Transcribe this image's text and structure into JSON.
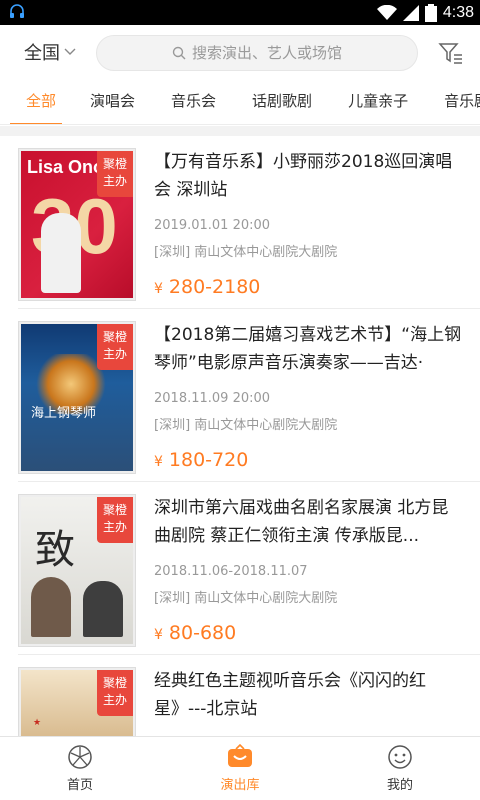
{
  "status_bar": {
    "time": "4:38"
  },
  "top_bar": {
    "city": "全国",
    "search_placeholder": "搜索演出、艺人或场馆"
  },
  "tabs": [
    {
      "label": "全部"
    },
    {
      "label": "演唱会"
    },
    {
      "label": "音乐会"
    },
    {
      "label": "话剧歌剧"
    },
    {
      "label": "儿童亲子"
    },
    {
      "label": "音乐剧"
    }
  ],
  "events": [
    {
      "badge": "聚橙\n主办",
      "poster_text": "Lisa Ono",
      "title": "【万有音乐系】小野丽莎2018巡回演唱会 深圳站",
      "date": "2019.01.01 20:00",
      "venue": "[深圳] 南山文体中心剧院大剧院",
      "currency": "¥",
      "price": "280-2180"
    },
    {
      "badge": "聚橙\n主办",
      "poster_text": "海上钢琴师",
      "title": "【2018第二届嬉习喜戏艺术节】“海上钢琴师”电影原声音乐演奏家——吉达·",
      "date": "2018.11.09 20:00",
      "venue": "[深圳] 南山文体中心剧院大剧院",
      "currency": "¥",
      "price": "180-720"
    },
    {
      "badge": "聚橙\n主办",
      "poster_text": "",
      "title": "深圳市第六届戏曲名剧名家展演 北方昆曲剧院 蔡正仁领衔主演 传承版昆...",
      "date": "2018.11.06-2018.11.07",
      "venue": "[深圳] 南山文体中心剧院大剧院",
      "currency": "¥",
      "price": "80-680"
    },
    {
      "badge": "聚橙\n主办",
      "poster_text": "",
      "title": "经典红色主题视听音乐会《闪闪的红星》---北京站",
      "date": "",
      "venue": "",
      "currency": "",
      "price": ""
    }
  ],
  "bottom_nav": [
    {
      "label": "首页",
      "icon": "home-icon"
    },
    {
      "label": "演出库",
      "icon": "show-library-icon"
    },
    {
      "label": "我的",
      "icon": "profile-icon"
    }
  ],
  "colors": {
    "accent": "#ff8a2b",
    "price": "#ff7b22",
    "badge": "#e8473c"
  }
}
